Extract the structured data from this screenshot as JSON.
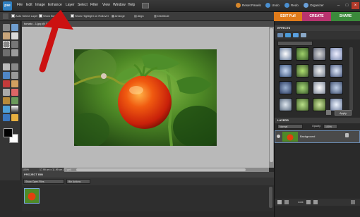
{
  "app": {
    "logo_text": "pse"
  },
  "menu": [
    "File",
    "Edit",
    "Image",
    "Enhance",
    "Layer",
    "Select",
    "Filter",
    "View",
    "Window",
    "Help"
  ],
  "top_actions": {
    "reset_panels": "Reset Panels",
    "undo": "Undo",
    "redo": "Redo",
    "organizer": "Organizer"
  },
  "mode_tabs": [
    {
      "label": "EDIT Full",
      "color": "#e07b1a"
    },
    {
      "label": "CREATE",
      "color": "#c2407d"
    },
    {
      "label": "SHARE",
      "color": "#3f8f3f"
    }
  ],
  "options_bar": {
    "auto_select_layer": "Auto Select Layer",
    "show_bounding": "Show Bounding",
    "show_highlight": "Show Highlight on Rollover",
    "arrange": "Arrange",
    "align": "Align",
    "distribute": "Distribute"
  },
  "document": {
    "tab_label": "tomato - 1.jpg @ 33.3%",
    "zoom": "100%",
    "doc_size": "17.99 cm x 11.99 cm (72 ppi)"
  },
  "project_bin": {
    "title": "PROJECT BIN",
    "show_select": "Show Open Files",
    "bin_actions": "Bin Actions"
  },
  "effects_panel": {
    "title": "EFFECTS",
    "apply": "Apply"
  },
  "layers_panel": {
    "title": "LAYERS",
    "blend_mode": "Normal",
    "opacity_label": "Opacity:",
    "opacity_value": "100%",
    "lock_label": "Lock:",
    "layer_name": "Background"
  },
  "colors": {
    "accent_edit": "#e07b1a",
    "arrow_red": "#cc1111"
  }
}
